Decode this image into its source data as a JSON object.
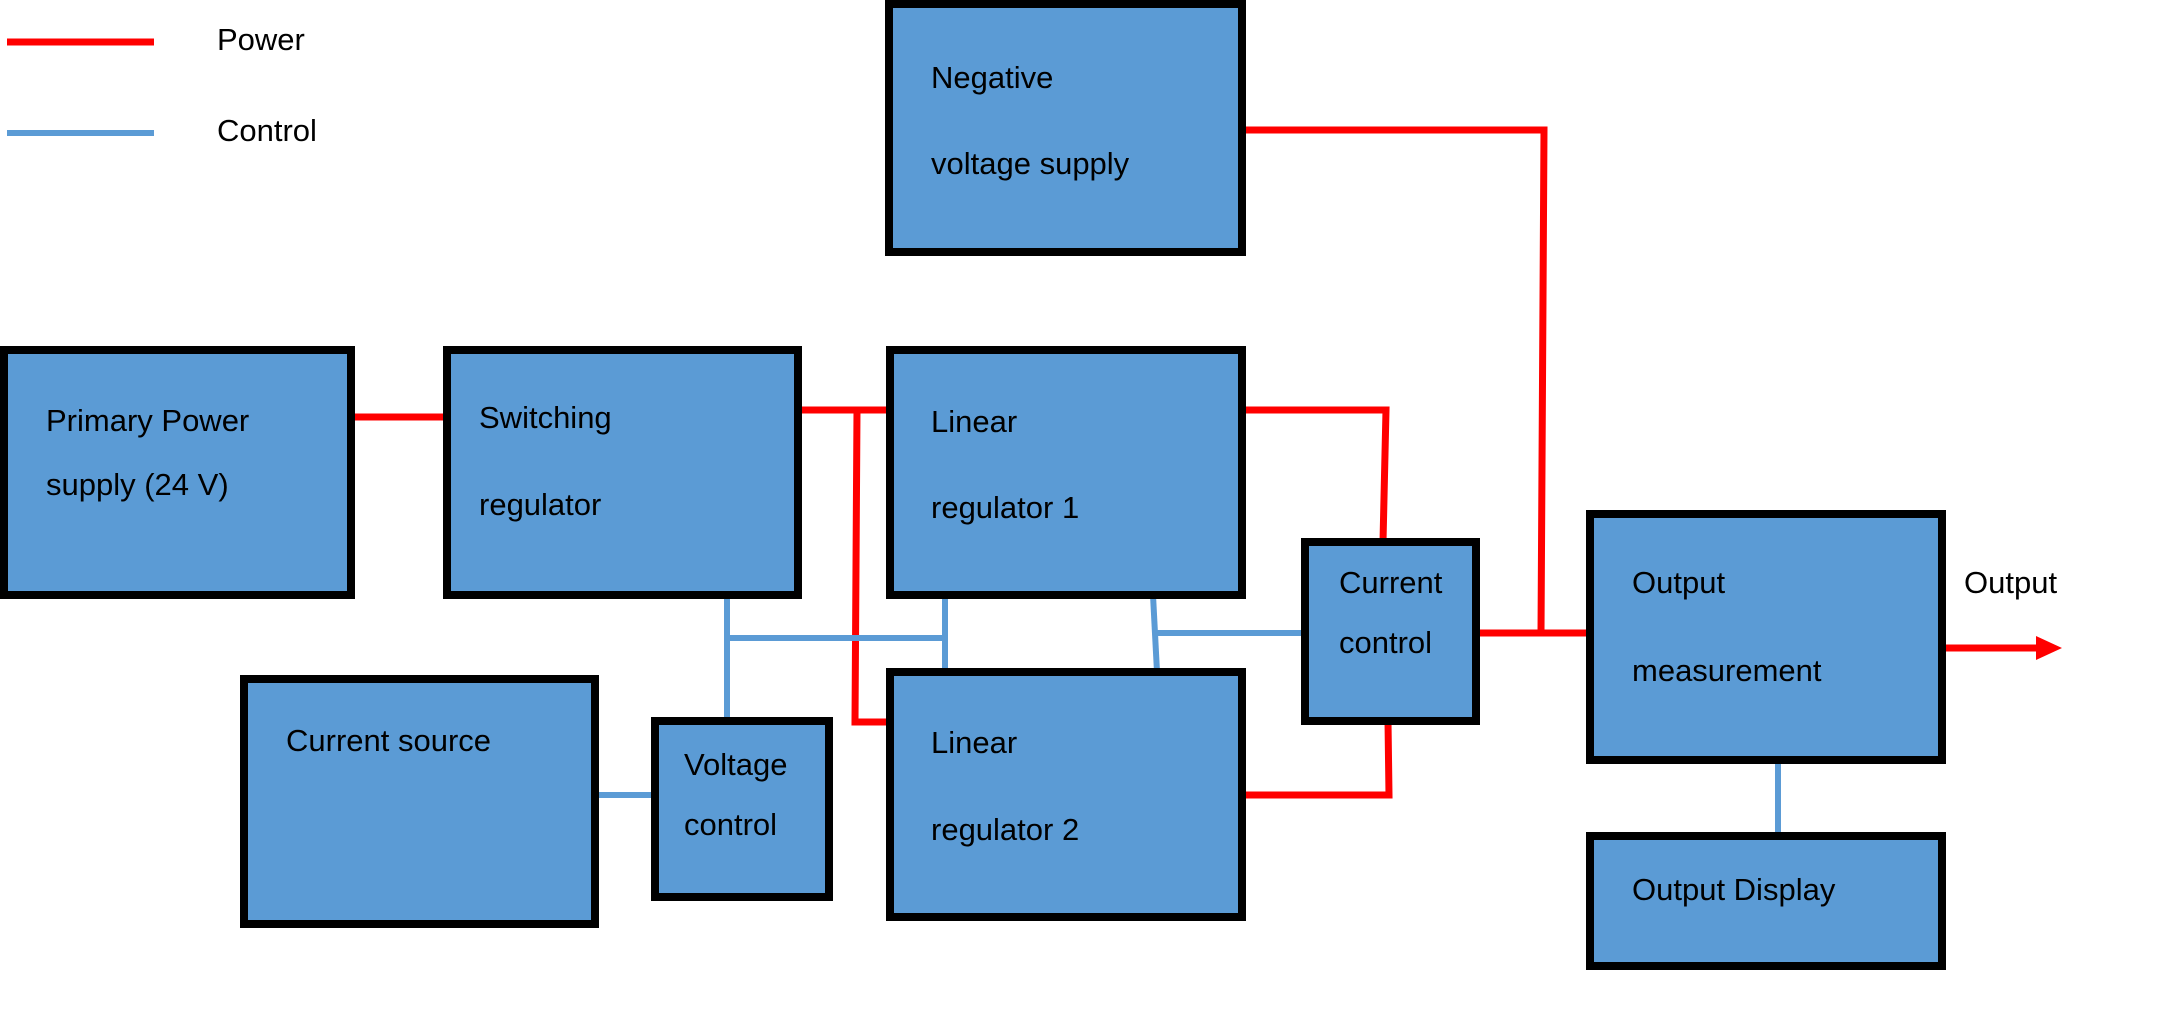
{
  "colors": {
    "power": "#FF0000",
    "control": "#5B9BD5",
    "block_fill": "#5B9BD5",
    "block_border": "#000000"
  },
  "legend": {
    "power": "Power",
    "control": "Control"
  },
  "blocks": {
    "negative": [
      "Negative",
      "voltage supply"
    ],
    "primary": [
      "Primary Power",
      "supply (24 V)"
    ],
    "switching": [
      "Switching",
      "regulator"
    ],
    "linear1": [
      "Linear",
      "regulator 1"
    ],
    "linear2": [
      "Linear",
      "regulator 2"
    ],
    "current_source": [
      "Current source"
    ],
    "voltage_control": [
      "Voltage",
      "control"
    ],
    "current_control": [
      "Current",
      "control"
    ],
    "output_measurement": [
      "Output",
      "measurement"
    ],
    "output_display": [
      "Output Display"
    ]
  },
  "output_label": "Output"
}
